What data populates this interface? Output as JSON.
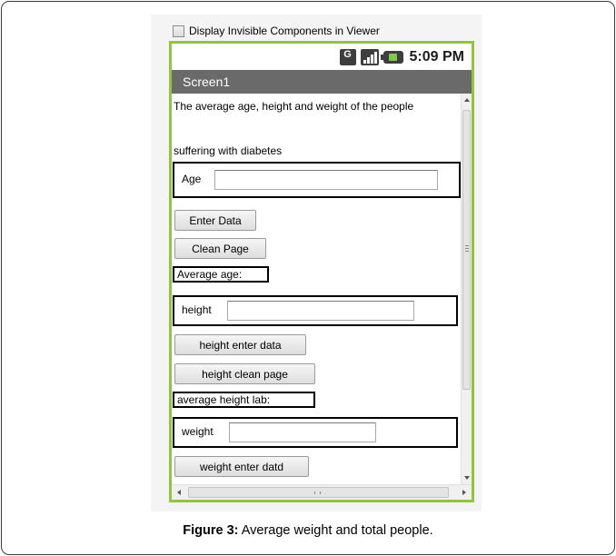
{
  "viewer": {
    "checkbox_label": "Display Invisible Components in Viewer",
    "checked": false
  },
  "statusbar": {
    "network_letter": "G",
    "time": "5:09 PM",
    "icons": [
      "network-type-icon",
      "signal-icon",
      "battery-icon"
    ]
  },
  "screen": {
    "title": "Screen1",
    "intro_line1": "The average age, height and weight of the people",
    "intro_line2": "suffering with diabetes",
    "age_label": "Age",
    "age_value": "",
    "enter_data_button": "Enter Data",
    "clean_page_button": "Clean Page",
    "average_age_label": "Average age:",
    "height_label": "height",
    "height_value": "",
    "height_enter_button": "height enter data",
    "height_clean_button": "height clean page",
    "average_height_label": "average height lab:",
    "weight_label": "weight",
    "weight_value": "",
    "weight_enter_button": "weight enter datd"
  },
  "scrollbars": {
    "horizontal_grip": "III"
  },
  "caption": {
    "label": "Figure 3:",
    "text": " Average weight and total people."
  },
  "colors": {
    "phone_border": "#92c341",
    "titlebar_bg": "#6a6a6a"
  }
}
